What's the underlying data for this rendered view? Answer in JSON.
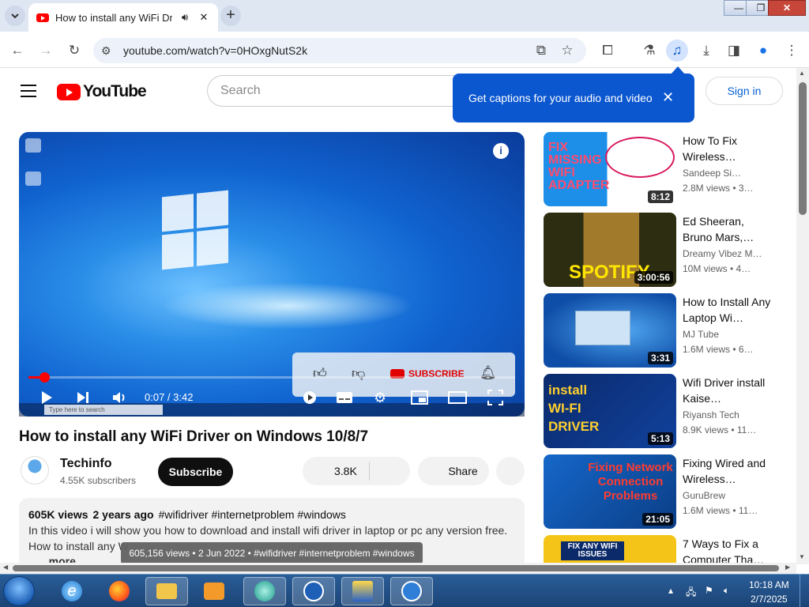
{
  "browser": {
    "tab": {
      "title": "How to install any WiFi Dri",
      "audio_icon": "speaker-icon",
      "close": "✕"
    },
    "new_tab": "+",
    "address": "youtube.com/watch?v=0HOxgNutS2k",
    "window_controls": {
      "minimize": "—",
      "maximize": "❐",
      "close": "✕"
    }
  },
  "youtube": {
    "logo_text": "YouTube",
    "search_placeholder": "Search",
    "sign_in": "Sign in",
    "caption_tip": "Get captions for your audio and video"
  },
  "player": {
    "time": "0:07 / 3:42",
    "progress": 0.032,
    "endcard_subscribe": "SUBSCRIBE",
    "taskbar_search": "Type here to search"
  },
  "video": {
    "title": "How to install any WiFi Driver on Windows 10/8/7",
    "channel": "Techinfo",
    "subscribers": "4.55K subscribers",
    "subscribe": "Subscribe",
    "likes": "3.8K",
    "share": "Share",
    "views": "605K views",
    "age": "2 years ago",
    "tags": "#wifidriver #internetproblem #windows",
    "desc_line1": "In this video i will show you how to download and install wifi driver in laptop or pc any version free.",
    "desc_line2": "How to install any W",
    "desc_more": "...more",
    "tooltip": "605,156 views • 2 Jun 2022 • #wifidriver #internetproblem #windows"
  },
  "recommendations": [
    {
      "title": "How To Fix Wireless…",
      "channel": "Sandeep Si…",
      "meta": "2.8M views  • 3…",
      "duration": "8:12",
      "thumb_text": "FIX MISSING WIFI ADAPTER"
    },
    {
      "title": "Ed Sheeran, Bruno Mars,…",
      "channel": "Dreamy Vibez M…",
      "meta": "10M views  • 4…",
      "duration": "3:00:56",
      "thumb_text": "SPOTIFY"
    },
    {
      "title": "How to Install Any Laptop Wi…",
      "channel": "MJ Tube",
      "meta": "1.6M views  • 6…",
      "duration": "3:31"
    },
    {
      "title": "Wifi Driver install Kaise…",
      "channel": "Riyansh Tech",
      "meta": "8.9K views  • 11…",
      "duration": "5:13",
      "thumb_text": "install WI-FI DRIVER"
    },
    {
      "title": "Fixing Wired and Wireless…",
      "channel": "GuruBrew",
      "meta": "1.6M views  • 11…",
      "duration": "21:05",
      "thumb_text": "Fixing Network Connection Problems"
    },
    {
      "title": "7 Ways to Fix a Computer Tha…",
      "channel": "",
      "meta": "",
      "duration": "",
      "thumb_text": "FIX ANY WIFI ISSUES"
    }
  ],
  "taskbar": {
    "time": "10:18 AM",
    "date": "2/7/2025",
    "apps": [
      "internet-explorer-icon",
      "firefox-icon",
      "file-explorer-icon",
      "media-player-icon",
      "app-green-icon",
      "wifi-icon",
      "install-icon",
      "tools-icon"
    ]
  },
  "colors": {
    "youtube_red": "#ff0000",
    "caption_blue": "#0b57d0",
    "link_blue": "#065fd4",
    "taskbar_blue": "#1b4476"
  }
}
